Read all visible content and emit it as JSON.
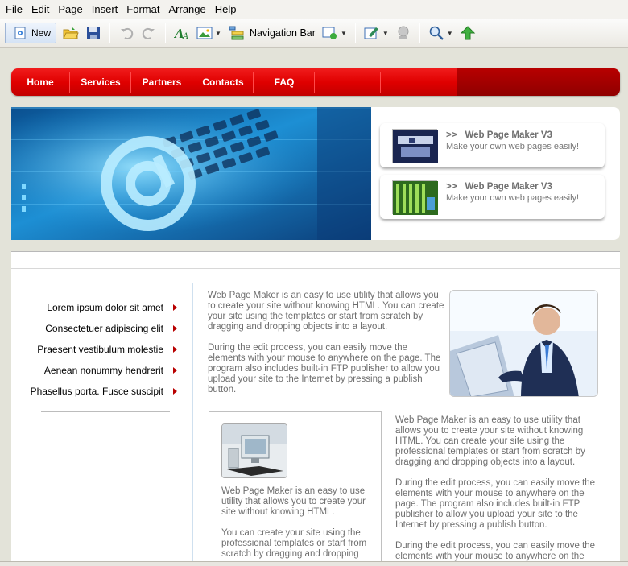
{
  "menu": [
    {
      "pre": "",
      "key": "F",
      "post": "ile"
    },
    {
      "pre": "",
      "key": "E",
      "post": "dit"
    },
    {
      "pre": "",
      "key": "P",
      "post": "age"
    },
    {
      "pre": "",
      "key": "I",
      "post": "nsert"
    },
    {
      "pre": "Form",
      "key": "a",
      "post": "t"
    },
    {
      "pre": "",
      "key": "A",
      "post": "rrange"
    },
    {
      "pre": "",
      "key": "H",
      "post": "elp"
    }
  ],
  "toolbar": {
    "new_label": "New",
    "navigation_bar_label": "Navigation Bar"
  },
  "nav": {
    "items": [
      "Home",
      "Services",
      "Partners",
      "Contacts",
      "FAQ"
    ]
  },
  "promos": [
    {
      "arrow": ">>",
      "title": "Web Page Maker V3",
      "subtitle": "Make your own web pages easily!"
    },
    {
      "arrow": ">>",
      "title": "Web Page Maker V3",
      "subtitle": "Make your own web pages easily!"
    }
  ],
  "sidebar": {
    "items": [
      "Lorem ipsum dolor sit amet",
      "Consectetuer adipiscing elit",
      "Praesent vestibulum molestie",
      "Aenean nonummy hendrerit",
      "Phasellus porta. Fusce suscipit"
    ]
  },
  "main": {
    "intro_1": "Web Page Maker is an easy to use utility that allows you to create your site without knowing HTML. You can create your site using the templates or start from scratch by dragging and dropping objects into a layout.",
    "intro_2": "During the edit process, you can easily move the elements with your mouse to anywhere on the page. The program also includes built-in FTP publisher to allow you upload your site to the Internet by pressing a publish button.",
    "box_1": "Web Page Maker is an easy to use utility that allows you to create your site without knowing HTML.",
    "box_2": "You can create your site using the professional templates or start from scratch by dragging and dropping",
    "right_1": "Web Page Maker is an easy to use utility that allows you to create your site without knowing HTML. You can create your site using the professional templates or start from scratch by dragging and dropping objects into a layout.",
    "right_2": "During the edit process, you can easily move the elements with your mouse to anywhere on the page. The program also includes built-in FTP publisher to allow you upload your site to the Internet by pressing a publish button.",
    "right_3": "During the edit process, you can easily move the elements with your mouse to anywhere on the page."
  },
  "colors": {
    "nav_red": "#e00000",
    "text_gray": "#6e6e6e",
    "bullet_red": "#b80000"
  }
}
